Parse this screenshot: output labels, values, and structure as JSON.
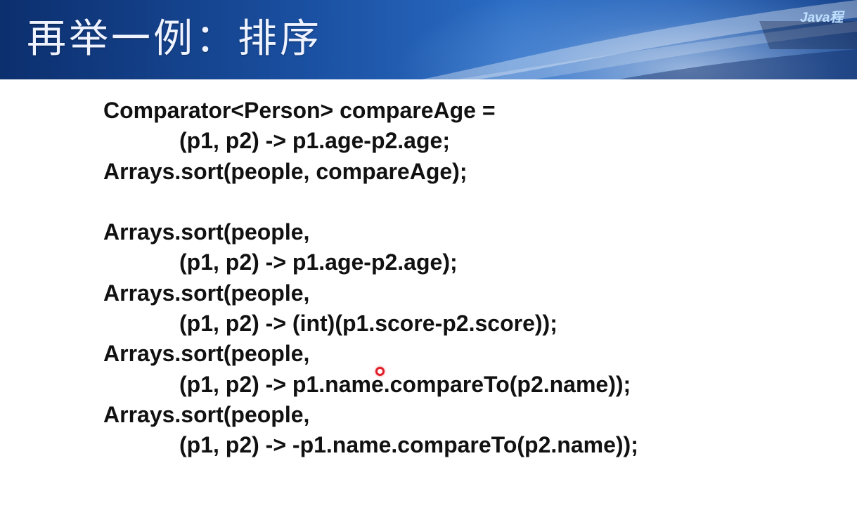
{
  "slide": {
    "title": "再举一例：排序",
    "logo_text": "Java程",
    "code_lines": [
      {
        "text": "Comparator<Person> compareAge =",
        "indent": false
      },
      {
        "text": "(p1, p2) -> p1.age-p2.age;",
        "indent": true
      },
      {
        "text": "Arrays.sort(people, compareAge);",
        "indent": false
      },
      {
        "text": "",
        "indent": false
      },
      {
        "text": "Arrays.sort(people,",
        "indent": false
      },
      {
        "text": "(p1, p2) -> p1.age-p2.age);",
        "indent": true
      },
      {
        "text": "Arrays.sort(people,",
        "indent": false
      },
      {
        "text": "(p1, p2) -> (int)(p1.score-p2.score));",
        "indent": true
      },
      {
        "text": "Arrays.sort(people,",
        "indent": false
      },
      {
        "text": "(p1, p2) -> p1.name.compareTo(p2.name));",
        "indent": true
      },
      {
        "text": "Arrays.sort(people,",
        "indent": false
      },
      {
        "text": "(p1, p2) -> -p1.name.compareTo(p2.name));",
        "indent": true
      }
    ]
  },
  "colors": {
    "header_dark": "#0c2f6e",
    "header_mid": "#2a6cc4",
    "title_text": "#eef3ff",
    "code_text": "#111111",
    "cursor_ring": "#e0202a"
  },
  "icons": {
    "pointer": "laser-pointer-dot"
  }
}
